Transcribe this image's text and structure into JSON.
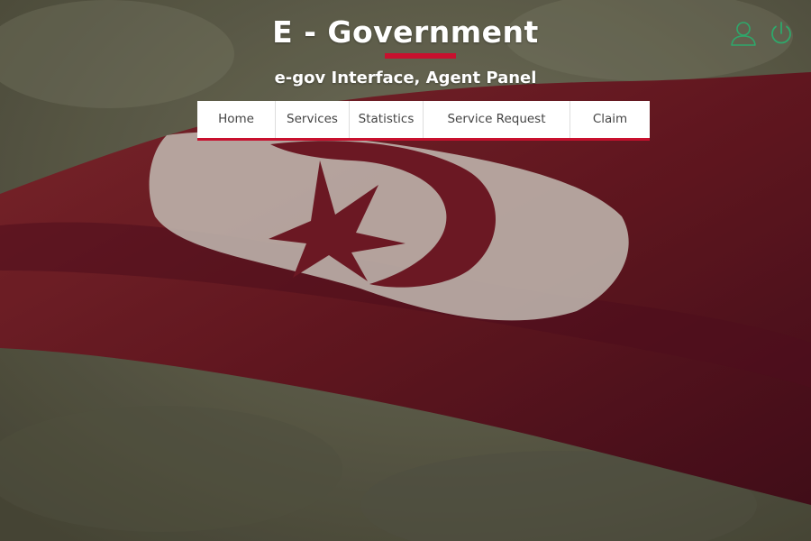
{
  "header": {
    "title": "E - Government",
    "subtitle": "e-gov Interface, Agent Panel"
  },
  "nav": {
    "items": [
      {
        "label": "Home"
      },
      {
        "label": "Services"
      },
      {
        "label": "Statistics"
      },
      {
        "label": "Service Request"
      },
      {
        "label": "Claim"
      }
    ]
  },
  "icons": {
    "user": "user-icon",
    "power": "power-icon"
  },
  "colors": {
    "accent": "#c8102e",
    "icon": "#2ea86b",
    "background": "#6b6a52"
  }
}
